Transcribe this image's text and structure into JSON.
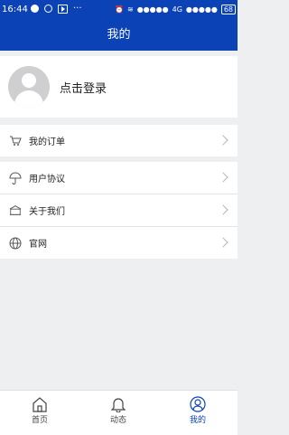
{
  "status_bar": {
    "time": "16:44",
    "network": "4G",
    "battery": "68"
  },
  "header": {
    "title": "我的"
  },
  "profile": {
    "login_label": "点击登录"
  },
  "menu_groups": [
    {
      "items": [
        {
          "label": "我的订单",
          "icon": "cart-icon"
        }
      ]
    },
    {
      "items": [
        {
          "label": "用户协议",
          "icon": "umbrella-icon"
        },
        {
          "label": "关于我们",
          "icon": "building-icon"
        },
        {
          "label": "官网",
          "icon": "globe-icon"
        }
      ]
    }
  ],
  "tab_bar": {
    "tabs": [
      {
        "label": "首页",
        "icon": "home-icon"
      },
      {
        "label": "动态",
        "icon": "bell-icon"
      },
      {
        "label": "我的",
        "icon": "user-icon",
        "active": true
      }
    ]
  },
  "colors": {
    "primary": "#0b42b6",
    "background": "#eeeff1"
  }
}
